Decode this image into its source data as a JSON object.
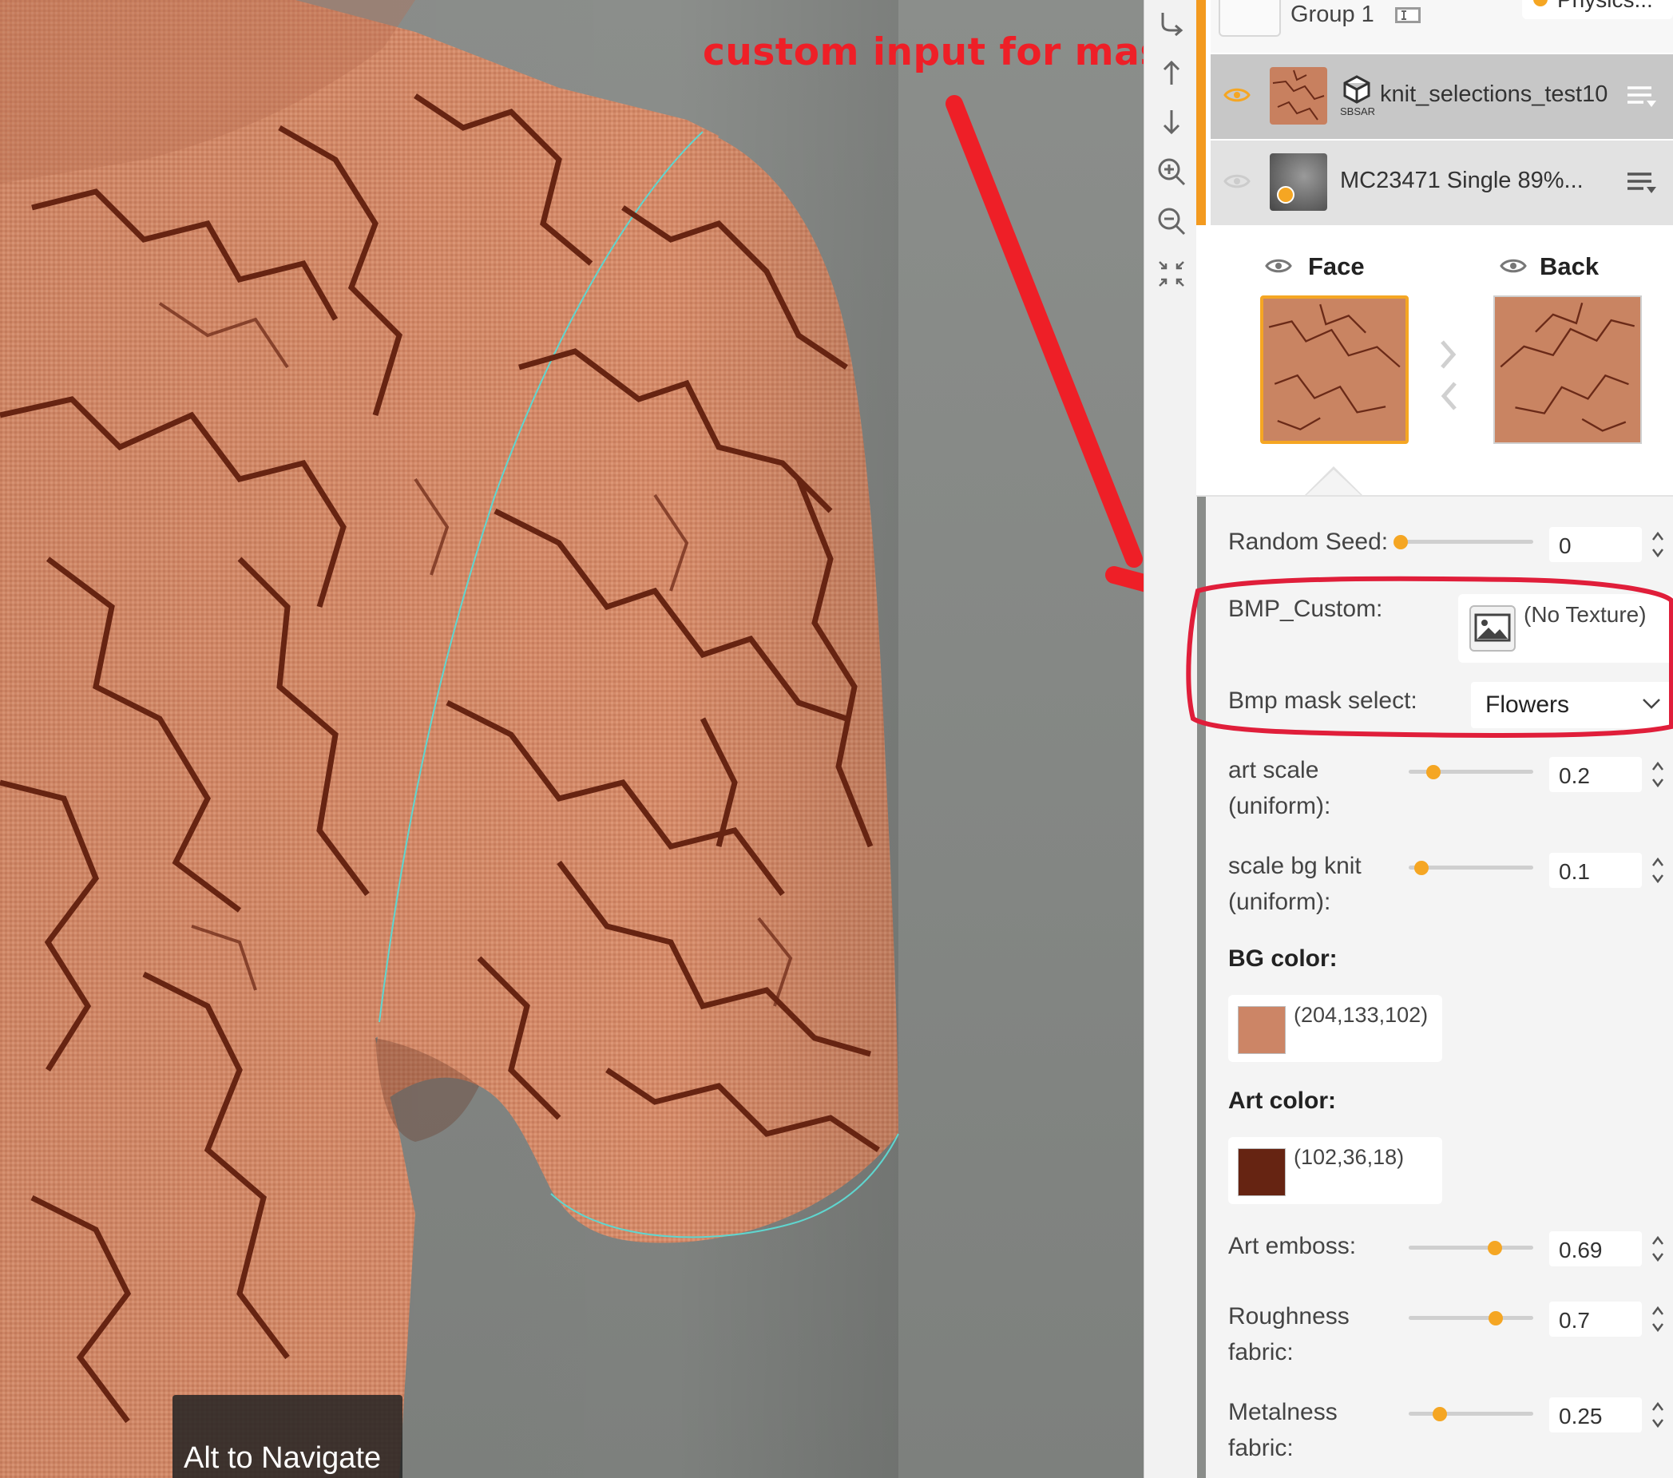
{
  "annotation": {
    "title": "custom input for mask"
  },
  "viewport": {
    "nav_hint": "Alt to Navigate"
  },
  "toolbar": {
    "icons": [
      "redo-icon",
      "move-up-icon",
      "move-down-icon",
      "zoom-in-icon",
      "zoom-out-icon",
      "collapse-icon"
    ]
  },
  "layers": {
    "group": {
      "label": "Group 1",
      "physics_label": "Physics..."
    },
    "items": [
      {
        "name": "knit_selections_test10",
        "badge": "SBSAR",
        "visible": true,
        "selected": true
      },
      {
        "name": "MC23471 Single 89%...",
        "visible": false,
        "selected": false
      }
    ]
  },
  "sides": {
    "face_label": "Face",
    "back_label": "Back"
  },
  "params": {
    "random_seed": {
      "label": "Random Seed:",
      "value": "0",
      "fraction": 0.0
    },
    "bmp_custom": {
      "label": "BMP_Custom:",
      "texture": "(No Texture)"
    },
    "bmp_mask": {
      "label": "Bmp mask select:",
      "selected": "Flowers"
    },
    "art_scale": {
      "label_line1": "art scale",
      "label_line2": "(uniform):",
      "value": "0.2",
      "fraction": 0.2
    },
    "scale_bg": {
      "label_line1": "scale bg knit",
      "label_line2": "(uniform):",
      "value": "0.1",
      "fraction": 0.1
    },
    "bg_color": {
      "label": "BG color:",
      "value": "(204,133,102)",
      "hex": "#cc8566"
    },
    "art_color": {
      "label": "Art color:",
      "value": "(102,36,18)",
      "hex": "#662412"
    },
    "art_emboss": {
      "label": "Art emboss:",
      "value": "0.69",
      "fraction": 0.69
    },
    "roughness": {
      "label_line1": "Roughness",
      "label_line2": "fabric:",
      "value": "0.7",
      "fraction": 0.7
    },
    "metalness": {
      "label_line1": "Metalness",
      "label_line2": "fabric:",
      "value": "0.25",
      "fraction": 0.25
    }
  },
  "colors": {
    "accent": "#f5a623",
    "annotation_red": "#ee1f27",
    "fabric": "#cc8566",
    "art": "#662412"
  }
}
